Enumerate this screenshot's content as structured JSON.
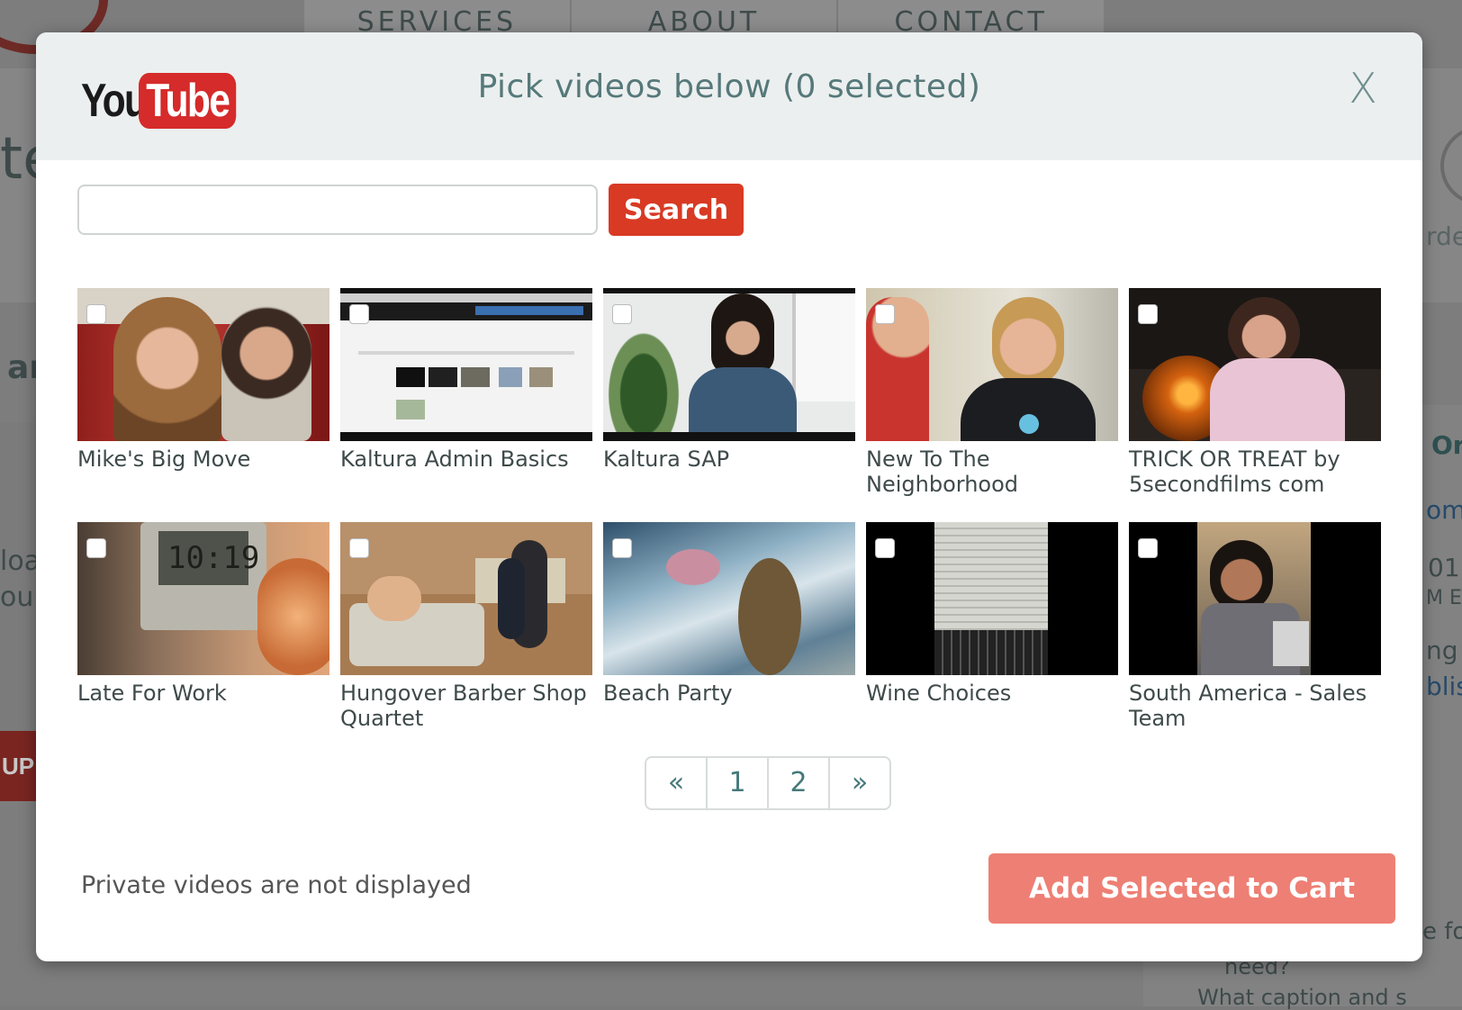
{
  "background": {
    "nav": [
      "SERVICES",
      "ABOUT",
      "CONTACT"
    ],
    "fragments": {
      "left_te": "te",
      "left_ar": "ar",
      "left_loa": "loa",
      "left_our": "our",
      "left_up": "UP",
      "right_rde": "rde",
      "right_ord": "Or",
      "right_om": "om",
      "right_01": "01",
      "right_met": "M ET",
      "right_ng": "ng",
      "right_blis": "blis",
      "right_dot": ".",
      "right_fo": "e fo",
      "right_need": "need?",
      "right_caption": "What caption and s"
    }
  },
  "modal": {
    "logo": {
      "you": "You",
      "tube": "Tube"
    },
    "title": "Pick videos below (0 selected)",
    "close_label": "X",
    "search": {
      "value": "",
      "placeholder": "",
      "button_label": "Search"
    },
    "videos": [
      {
        "title": "Mike's Big Move",
        "selected": false
      },
      {
        "title": "Kaltura Admin Basics",
        "selected": false
      },
      {
        "title": "Kaltura SAP",
        "selected": false
      },
      {
        "title": "New To The Neighborhood",
        "selected": false
      },
      {
        "title": "TRICK OR TREAT by 5secondfilms com",
        "selected": false
      },
      {
        "title": "Late For Work",
        "selected": false
      },
      {
        "title": "Hungover Barber Shop Quartet",
        "selected": false
      },
      {
        "title": "Beach Party",
        "selected": false
      },
      {
        "title": "Wine Choices",
        "selected": false
      },
      {
        "title": "South America - Sales Team",
        "selected": false
      }
    ],
    "pagination": {
      "prev": "«",
      "pages": [
        "1",
        "2"
      ],
      "next": "»"
    },
    "footer_note": "Private videos are not displayed",
    "add_button_label": "Add Selected to Cart",
    "colors": {
      "accent_red": "#d83a24",
      "add_button": "#ee7f74",
      "title_teal": "#56797a",
      "header_bg": "#ecefef"
    }
  }
}
